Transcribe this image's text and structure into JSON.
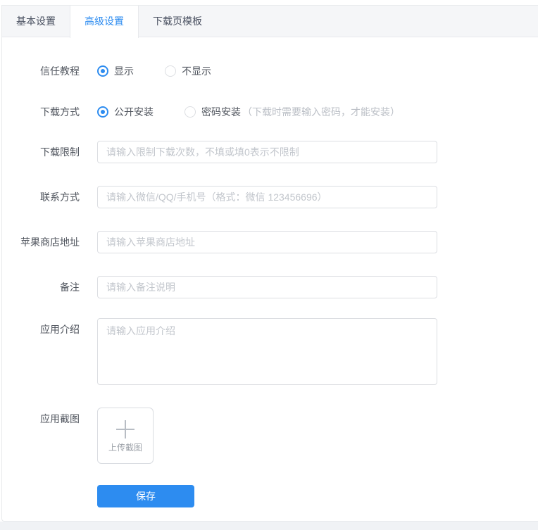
{
  "tabs": {
    "items": [
      {
        "label": "基本设置",
        "active": false
      },
      {
        "label": "高级设置",
        "active": true
      },
      {
        "label": "下载页模板",
        "active": false
      }
    ]
  },
  "form": {
    "trust_tutorial": {
      "label": "信任教程",
      "options": [
        {
          "label": "显示",
          "selected": true
        },
        {
          "label": "不显示",
          "selected": false
        }
      ]
    },
    "download_method": {
      "label": "下载方式",
      "options": [
        {
          "label": "公开安装",
          "selected": true
        },
        {
          "label": "密码安装",
          "selected": false
        }
      ],
      "note": "（下载时需要输入密码，才能安装）"
    },
    "download_limit": {
      "label": "下载限制",
      "placeholder": "请输入限制下载次数，不填或填0表示不限制",
      "value": ""
    },
    "contact": {
      "label": "联系方式",
      "placeholder": "请输入微信/QQ/手机号（格式：微信 123456696）",
      "value": ""
    },
    "apple_store": {
      "label": "苹果商店地址",
      "placeholder": "请输入苹果商店地址",
      "value": ""
    },
    "remark": {
      "label": "备注",
      "placeholder": "请输入备注说明",
      "value": ""
    },
    "app_intro": {
      "label": "应用介绍",
      "placeholder": "请输入应用介绍",
      "value": ""
    },
    "app_screenshot": {
      "label": "应用截图",
      "upload_text": "上传截图",
      "icon": "plus-icon"
    },
    "save_button": {
      "label": "保存"
    }
  },
  "colors": {
    "accent": "#2d8cf0",
    "header_bg": "#f5f6f8",
    "card_border": "#e8eaec",
    "input_border": "#dcdee2",
    "placeholder_text": "#c2c6cc",
    "label_text": "#50555e",
    "note_text": "#bbbfc6",
    "page_bottom_bg": "#f0f2f5"
  }
}
